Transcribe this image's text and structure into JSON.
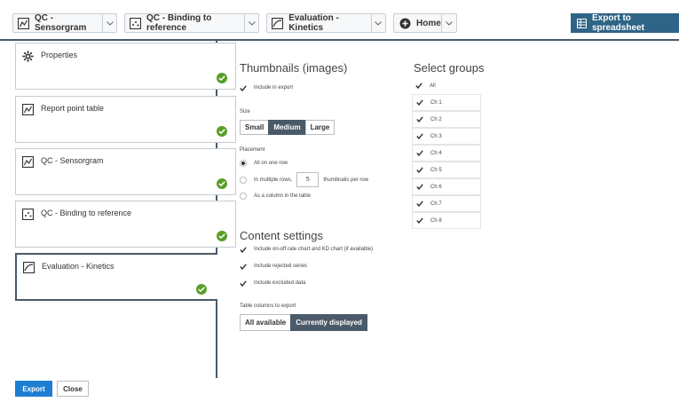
{
  "toolbar": {
    "tabs": [
      {
        "label": "QC - Sensorgram"
      },
      {
        "label": "QC - Binding to reference"
      },
      {
        "label": "Evaluation - Kinetics"
      },
      {
        "label": "Home"
      }
    ],
    "export_label": "Export to spreadsheet"
  },
  "sidebar": {
    "items": [
      {
        "label": "Properties"
      },
      {
        "label": "Report point table"
      },
      {
        "label": "QC - Sensorgram"
      },
      {
        "label": "QC - Binding to reference"
      },
      {
        "label": "Evaluation - Kinetics"
      }
    ]
  },
  "thumbnails": {
    "title": "Thumbnails (images)",
    "include_label": "Include in export",
    "size_label": "Size",
    "sizes": [
      "Small",
      "Medium",
      "Large"
    ],
    "selected_size": "Medium",
    "placement_label": "Placement",
    "opt_one_row": "All on one row",
    "opt_multi_prefix": "In multiple rows,",
    "per_row_value": "5",
    "opt_multi_suffix": "thumbnails per row",
    "opt_column": "As a column in the table"
  },
  "content": {
    "title": "Content settings",
    "opt1": "Include on-off rate chart and KD chart (if available)",
    "opt2": "Include rejected series",
    "opt3": "Include excluded data",
    "table_cols_label": "Table columns to export",
    "cols": [
      "All available",
      "Currently displayed"
    ],
    "selected_col": "Currently displayed"
  },
  "groups": {
    "title": "Select groups",
    "items": [
      "All",
      "Ch 1",
      "Ch 2",
      "Ch 3",
      "Ch 4",
      "Ch 5",
      "Ch 6",
      "Ch 7",
      "Ch 8"
    ]
  },
  "footer": {
    "export_label": "Export",
    "close_label": "Close"
  },
  "colors": {
    "accent": "#2e6486",
    "selected": "#4a5a68",
    "ok": "#5a9e2a",
    "primary": "#1e7fd2"
  }
}
